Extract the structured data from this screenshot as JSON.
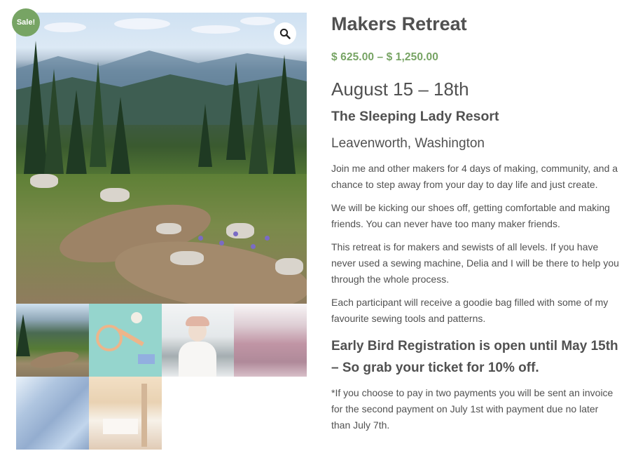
{
  "badge": {
    "sale_label": "Sale!"
  },
  "gallery": {
    "zoom_icon": "magnifying-glass-icon",
    "main_image": "mountain-trail-photo",
    "thumbnails": [
      {
        "name": "thumb-mountain-trail",
        "active": true
      },
      {
        "name": "thumb-sewing-tools",
        "active": false
      },
      {
        "name": "thumb-portrait",
        "active": false
      },
      {
        "name": "thumb-knit-fabric",
        "active": false
      },
      {
        "name": "thumb-blue-fabric",
        "active": false
      },
      {
        "name": "thumb-cabin-room",
        "active": false
      }
    ]
  },
  "product": {
    "title": "Makers Retreat",
    "price_range": "$ 625.00 – $ 1,250.00",
    "dates": "August 15 – 18th",
    "venue": "The Sleeping Lady Resort",
    "location": "Leavenworth, Washington",
    "paragraphs": [
      "Join me and other makers for 4 days of making, community, and a chance to step away from your day to day life and just create.",
      "We will be kicking our shoes off, getting comfortable and making friends.  You can never have too many maker friends.",
      "This retreat is for makers and sewists of all levels.  If you have never used a sewing machine, Delia and I will be there to help you through the whole process.",
      "Each participant will receive a goodie bag filled with some of my favourite sewing tools and patterns."
    ],
    "early_bird": "Early Bird Registration is open until May 15th – So grab your ticket for 10% off.",
    "footnote": "*If you choose to pay in two payments you will be sent an invoice for the second payment on July 1st with payment due no later than July 7th."
  },
  "colors": {
    "accent_green": "#77a464",
    "text": "#515151"
  }
}
